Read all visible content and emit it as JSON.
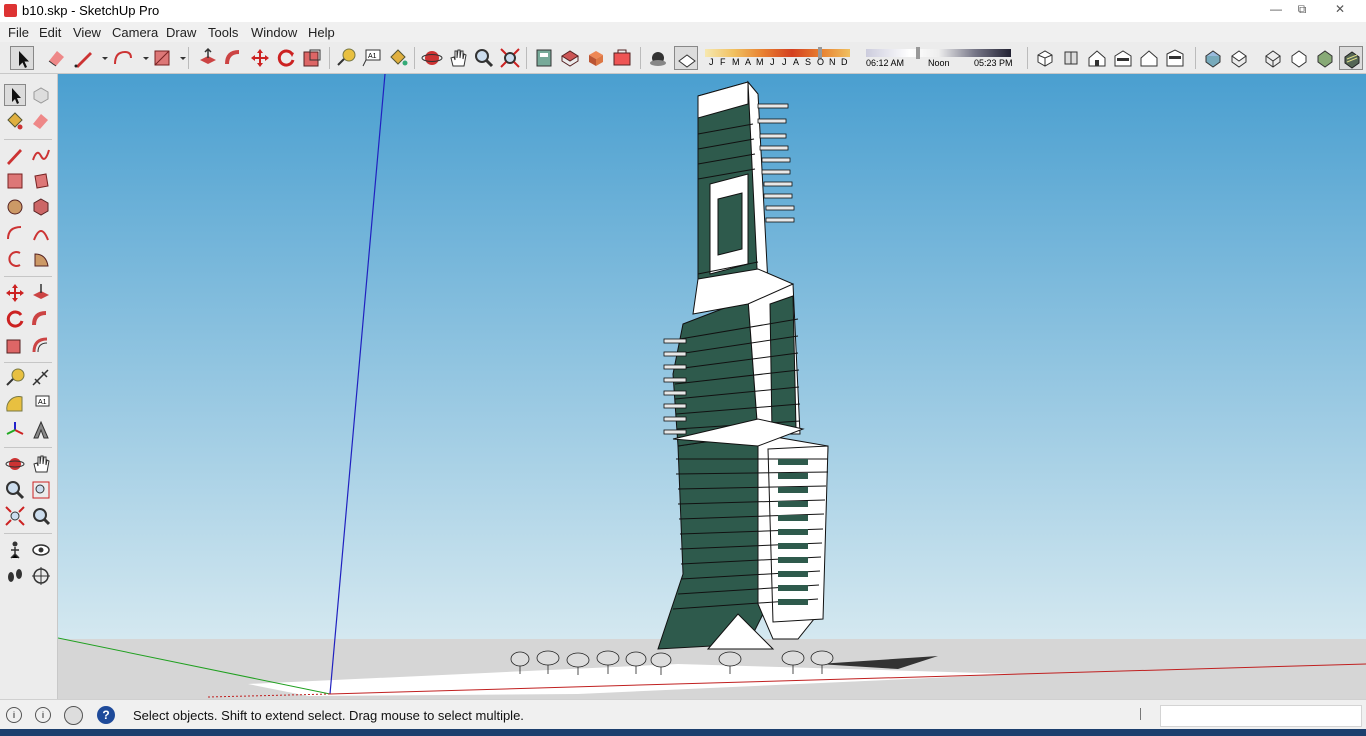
{
  "window": {
    "title": "b10.skp - SketchUp Pro",
    "minimize_glyph": "—",
    "restore_glyph": "⧉",
    "close_glyph": "✕"
  },
  "menu": [
    "File",
    "Edit",
    "View",
    "Camera",
    "Draw",
    "Tools",
    "Window",
    "Help"
  ],
  "shadow": {
    "months": [
      "J",
      "F",
      "M",
      "A",
      "M",
      "J",
      "J",
      "A",
      "S",
      "O",
      "N",
      "D"
    ],
    "time_start": "06:12 AM",
    "time_mid": "Noon",
    "time_end": "05:23 PM"
  },
  "status": {
    "message": "Select objects. Shift to extend select. Drag mouse to select multiple.",
    "help_glyph": "?",
    "info_glyph": "i"
  },
  "colors": {
    "sky_top": "#4a9fd0",
    "sky_bottom": "#d4e8f0",
    "ground": "#d6d6d6",
    "glass": "#2e5a4c",
    "axis_red": "#c02020",
    "axis_green": "#20a020",
    "axis_blue": "#2020c0"
  }
}
